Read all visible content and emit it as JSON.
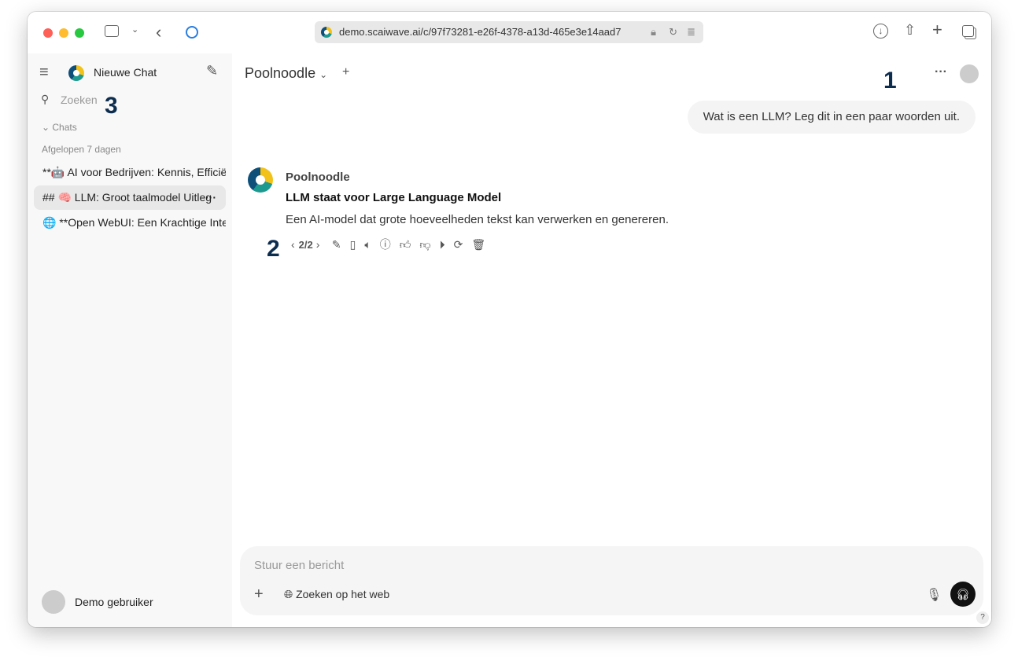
{
  "browser": {
    "url": "demo.scaiwave.ai/c/97f73281-e26f-4378-a13d-465e3e14aad7"
  },
  "sidebar": {
    "new_chat": "Nieuwe Chat",
    "search_placeholder": "Zoeken",
    "section": "Chats",
    "group": "Afgelopen 7 dagen",
    "items": [
      {
        "label": "**🤖 AI voor Bedrijven: Kennis, Efficiëntie"
      },
      {
        "label": "## 🧠 LLM: Groot taalmodel Uitleg"
      },
      {
        "label": "🌐 **Open WebUI: Een Krachtige Interface"
      }
    ],
    "user": "Demo gebruiker"
  },
  "header": {
    "model": "Poolnoodle"
  },
  "annotations": [
    "1",
    "2",
    "3"
  ],
  "messages": {
    "user": "Wat is een LLM? Leg dit in een paar woorden uit.",
    "assistant_name": "Poolnoodle",
    "assistant_title": "LLM staat voor Large Language Model",
    "assistant_body": "Een AI-model dat grote hoeveelheden tekst kan verwerken en genereren.",
    "pager": "2/2"
  },
  "composer": {
    "placeholder": "Stuur een bericht",
    "web_search": "Zoeken op het web"
  },
  "help": "?"
}
